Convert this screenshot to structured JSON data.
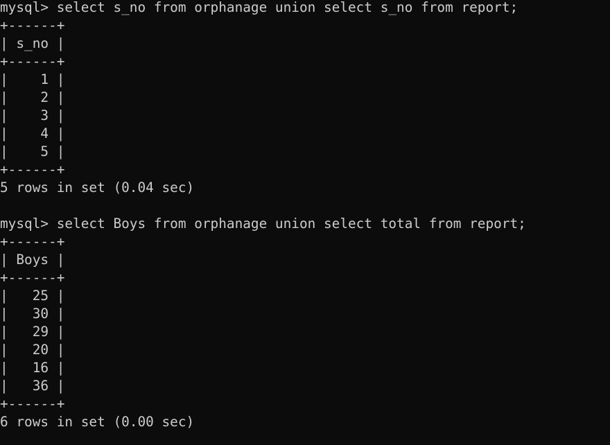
{
  "terminal": {
    "queries": [
      {
        "prompt": "mysql> ",
        "command": "select s_no from orphanage union select s_no from report;",
        "border": "+------+",
        "header": "| s_no |",
        "rows": [
          "|    1 |",
          "|    2 |",
          "|    3 |",
          "|    4 |",
          "|    5 |"
        ],
        "summary": "5 rows in set (0.04 sec)"
      },
      {
        "prompt": "mysql> ",
        "command": "select Boys from orphanage union select total from report;",
        "border": "+------+",
        "header": "| Boys |",
        "rows": [
          "|   25 |",
          "|   30 |",
          "|   29 |",
          "|   20 |",
          "|   16 |",
          "|   36 |"
        ],
        "summary": "6 rows in set (0.00 sec)"
      }
    ]
  }
}
